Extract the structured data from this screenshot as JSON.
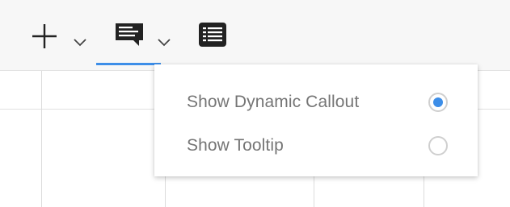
{
  "toolbar": {
    "tools": [
      {
        "icon": "plus-icon",
        "has_dropdown": true
      },
      {
        "icon": "callout-icon",
        "has_dropdown": true,
        "active": true
      },
      {
        "icon": "table-list-icon",
        "has_dropdown": false
      }
    ]
  },
  "colors": {
    "accent": "#3d8ee8",
    "toolbar_bg": "#f7f7f7",
    "label_text": "#757575",
    "icon": "#222222"
  },
  "dropdown": {
    "options": [
      {
        "label": "Show Dynamic Callout",
        "selected": true
      },
      {
        "label": "Show Tooltip",
        "selected": false
      }
    ]
  }
}
